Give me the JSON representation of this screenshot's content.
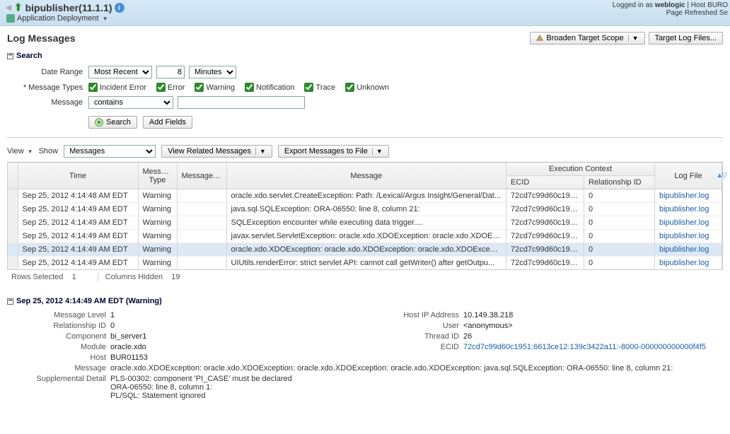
{
  "header": {
    "title": "bipublisher(11.1.1)",
    "loggedin_prefix": "Logged in as ",
    "loggedin_user": "weblogic",
    "host_label": "Host",
    "host_value": "BURO",
    "refreshed": "Page Refreshed Se",
    "submenu": "Application Deployment"
  },
  "page": {
    "title": "Log Messages",
    "broaden": "Broaden Target Scope",
    "target_log": "Target Log Files..."
  },
  "search": {
    "heading": "Search",
    "date_range_label": "Date Range",
    "date_range_value": "Most Recent",
    "date_num": "8",
    "date_unit": "Minutes",
    "msg_types_label": "Message Types",
    "types": [
      "Incident Error",
      "Error",
      "Warning",
      "Notification",
      "Trace",
      "Unknown"
    ],
    "message_label": "Message",
    "message_op": "contains",
    "search_btn": "Search",
    "add_fields_btn": "Add Fields"
  },
  "toolbar": {
    "view": "View",
    "show": "Show",
    "messages_select": "Messages",
    "view_related": "View Related Messages",
    "export": "Export Messages to File"
  },
  "table": {
    "headers": {
      "time": "Time",
      "msg_type": "Message Type",
      "msg_id": "Message ID",
      "message": "Message",
      "exec_ctx": "Execution Context",
      "ecid": "ECID",
      "rel_id": "Relationship ID",
      "log_file": "Log File"
    },
    "rows": [
      {
        "time": "Sep 25, 2012 4:14:48 AM EDT",
        "type": "Warning",
        "msgid": "",
        "msg": "oracle.xdo.servlet.CreateException: Path: /Lexical/Argus Insight/General/Dat...",
        "ecid": "72cd7c99d60c195...",
        "rel": "0",
        "log": "bipublisher.log"
      },
      {
        "time": "Sep 25, 2012 4:14:49 AM EDT",
        "type": "Warning",
        "msgid": "",
        "msg": "java.sql.SQLException: ORA-06550: line 8, column 21:",
        "ecid": "72cd7c99d60c195...",
        "rel": "0",
        "log": "bipublisher.log"
      },
      {
        "time": "Sep 25, 2012 4:14:49 AM EDT",
        "type": "Warning",
        "msgid": "",
        "msg": "SQLException encounter while executing data trigger....",
        "ecid": "72cd7c99d60c195...",
        "rel": "0",
        "log": "bipublisher.log"
      },
      {
        "time": "Sep 25, 2012 4:14:49 AM EDT",
        "type": "Warning",
        "msgid": "",
        "msg": "javax.servlet.ServletException: oracle.xdo.XDOException: oracle.xdo.XDOEx...",
        "ecid": "72cd7c99d60c195...",
        "rel": "0",
        "log": "bipublisher.log"
      },
      {
        "time": "Sep 25, 2012 4:14:49 AM EDT",
        "type": "Warning",
        "msgid": "",
        "msg": "oracle.xdo.XDOException: oracle.xdo.XDOException: oracle.xdo.XDOExcepti...",
        "ecid": "72cd7c99d60c195...",
        "rel": "0",
        "log": "bipublisher.log",
        "selected": true
      },
      {
        "time": "Sep 25, 2012 4:14:49 AM EDT",
        "type": "Warning",
        "msgid": "",
        "msg": "UIUtils.renderError: strict servlet API: cannot call getWriter() after getOutpu...",
        "ecid": "72cd7c99d60c195...",
        "rel": "0",
        "log": "bipublisher.log"
      }
    ],
    "rows_selected_label": "Rows Selected",
    "rows_selected": "1",
    "cols_hidden_label": "Columns Hidden",
    "cols_hidden": "19"
  },
  "detail": {
    "title": "Sep 25, 2012 4:14:49 AM EDT (Warning)",
    "fields_left": [
      {
        "label": "Message Level",
        "value": "1"
      },
      {
        "label": "Relationship ID",
        "value": "0"
      },
      {
        "label": "Component",
        "value": "bi_server1"
      },
      {
        "label": "Module",
        "value": "oracle.xdo"
      },
      {
        "label": "Host",
        "value": "BUR01153"
      }
    ],
    "fields_right": [
      {
        "label": "Host IP Address",
        "value": "10.149.38.218"
      },
      {
        "label": "User",
        "value": "<anonymous>"
      },
      {
        "label": "Thread ID",
        "value": "26"
      },
      {
        "label": "ECID",
        "value": "72cd7c99d60c1951:6613ce12:139c3422a11:-8000-000000000000f4f5",
        "link": true
      }
    ],
    "message_label": "Message",
    "message": "oracle.xdo.XDOException: oracle.xdo.XDOException: oracle.xdo.XDOException: oracle.xdo.XDOException: java.sql.SQLException: ORA-06550: line 8, column 21:",
    "supp_label": "Supplemental Detail",
    "supp": "PLS-00302: component 'PI_CASE' must be declared\nORA-06550: line 8, column 1:\nPL/SQL: Statement ignored"
  }
}
